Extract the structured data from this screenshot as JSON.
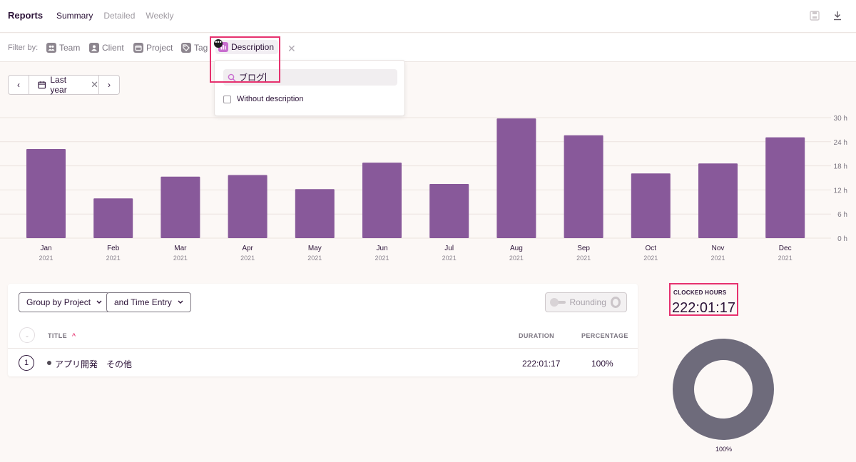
{
  "header": {
    "title": "Reports",
    "tabs": [
      "Summary",
      "Detailed",
      "Weekly"
    ],
    "active_tab": "Summary",
    "icons": [
      "save-icon",
      "download-icon"
    ]
  },
  "filters": {
    "label": "Filter by:",
    "items": [
      "Team",
      "Client",
      "Project",
      "Tag",
      "Description"
    ],
    "active": "Description"
  },
  "description_dropdown": {
    "search_value": "ブログ",
    "option_label": "Without description",
    "option_checked": false
  },
  "date_range": {
    "label": "Last year"
  },
  "chart_data": {
    "type": "bar",
    "categories": [
      "Jan",
      "Feb",
      "Mar",
      "Apr",
      "May",
      "Jun",
      "Jul",
      "Aug",
      "Sep",
      "Oct",
      "Nov",
      "Dec"
    ],
    "category_sublabels": [
      "2021",
      "2021",
      "2021",
      "2021",
      "2021",
      "2021",
      "2021",
      "2021",
      "2021",
      "2021",
      "2021",
      "2021"
    ],
    "values": [
      22.2,
      9.9,
      15.3,
      15.7,
      12.2,
      18.8,
      13.5,
      29.8,
      25.6,
      16.1,
      18.6,
      25.1
    ],
    "ylim": [
      0,
      30
    ],
    "y_ticks": [
      "0 h",
      "6 h",
      "12 h",
      "18 h",
      "24 h",
      "30 h"
    ],
    "y_tick_values": [
      0,
      6,
      12,
      18,
      24,
      30
    ],
    "grid": true,
    "bar_color": "#88599a"
  },
  "table": {
    "group_by_label": "Group by Project",
    "then_by_label": "and Time Entry",
    "rounding_label": "Rounding",
    "columns": {
      "title": "TITLE",
      "duration": "DURATION",
      "percentage": "PERCENTAGE"
    },
    "rows": [
      {
        "index": "1",
        "title": "アプリ開発　その他",
        "duration": "222:01:17",
        "percentage": "100%"
      }
    ]
  },
  "summary": {
    "clocked_label": "CLOCKED HOURS",
    "clocked_value": "222:01:17",
    "donut_percent": "100%",
    "donut_color": "#6e6b7b"
  },
  "colors": {
    "accent": "#e6316e",
    "bar": "#88599a",
    "text": "#2c1338"
  }
}
